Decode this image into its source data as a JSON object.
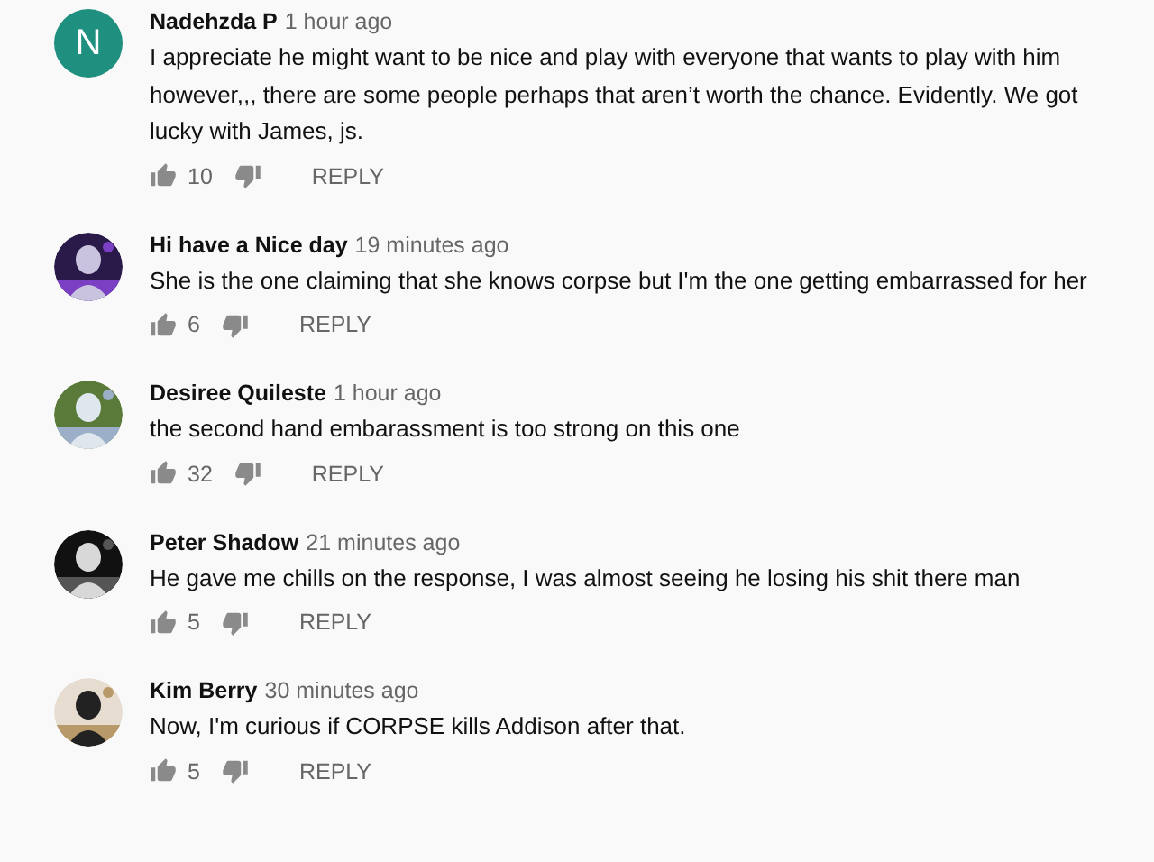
{
  "comments": [
    {
      "author": "Nadehzda P",
      "time": "1 hour ago",
      "text": "I appreciate he might want to be nice and play with everyone that wants to play with him however,,, there are some people perhaps that aren’t worth the chance. Evidently. We got lucky with James, js.",
      "likes": "10",
      "reply": "REPLY",
      "avatar": {
        "kind": "letter",
        "letter": "N",
        "color": "#1f8f7f"
      }
    },
    {
      "author": "Hi have a Nice day",
      "time": "19 minutes ago",
      "text": "She is the one claiming that she knows corpse but I'm the one getting embarrassed for her",
      "likes": "6",
      "reply": "REPLY"
    },
    {
      "author": "Desiree Quileste",
      "time": "1 hour ago",
      "text": "the second hand embarassment is too strong on this one",
      "likes": "32",
      "reply": "REPLY"
    },
    {
      "author": "Peter Shadow",
      "time": "21 minutes ago",
      "text": "He gave me chills on the response,  I was almost seeing he losing his shit there man",
      "likes": "5",
      "reply": "REPLY"
    },
    {
      "author": "Kim Berry",
      "time": "30 minutes ago",
      "text": "Now, I'm curious if CORPSE kills Addison after that.",
      "likes": "5",
      "reply": "REPLY"
    }
  ]
}
